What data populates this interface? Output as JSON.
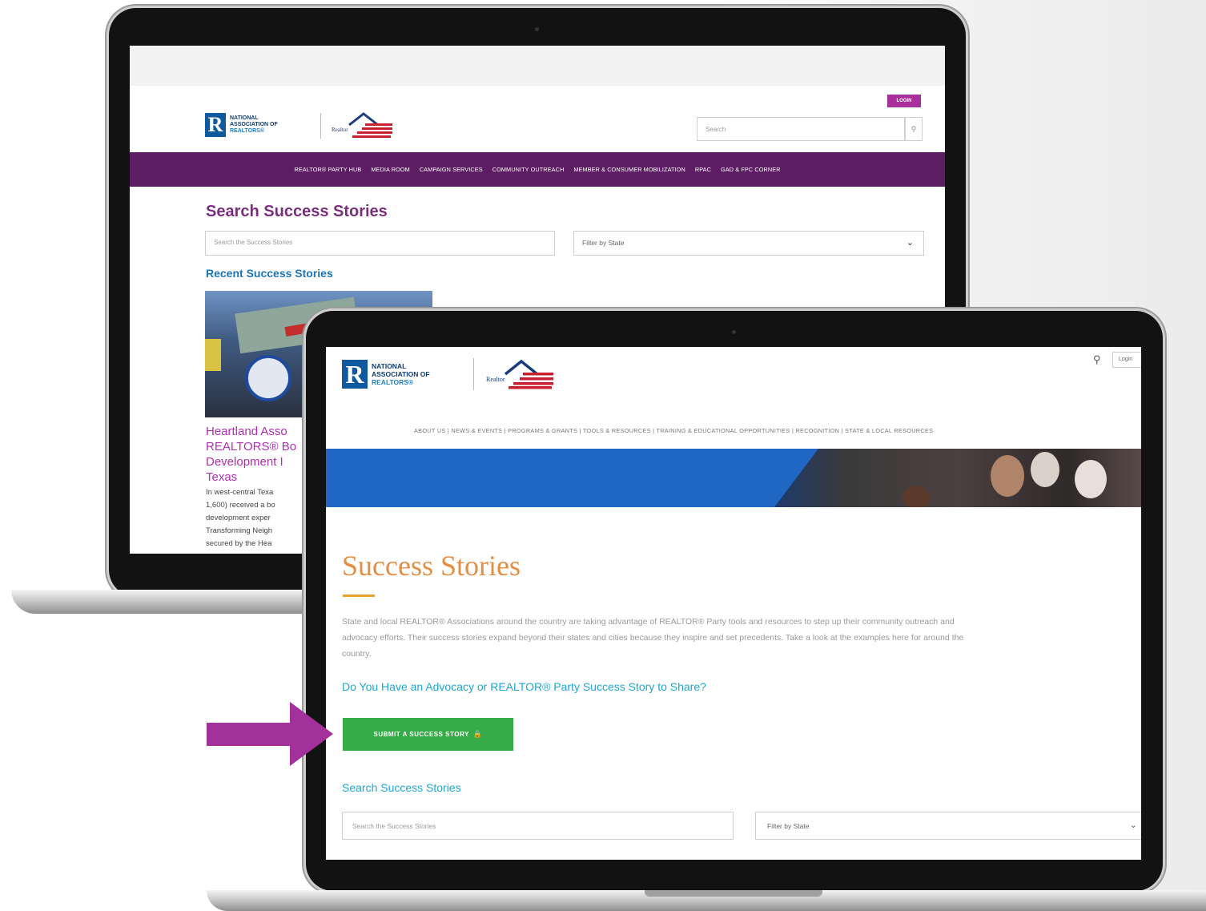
{
  "back": {
    "logo": {
      "line1": "NATIONAL",
      "line2": "ASSOCIATION OF",
      "line3": "REALTORS®"
    },
    "login_label": "LOGIN",
    "search_placeholder": "Search",
    "nav": [
      "REALTOR® PARTY HUB",
      "MEDIA ROOM",
      "CAMPAIGN SERVICES",
      "COMMUNITY OUTREACH",
      "MEMBER & CONSUMER MOBILIZATION",
      "RPAC",
      "GAD & FPC CORNER"
    ],
    "page_title": "Search Success Stories",
    "story_search_placeholder": "Search the Success Stories",
    "state_filter": "Filter by State",
    "recent_heading": "Recent Success Stories",
    "story": {
      "title_lines": [
        "Heartland Asso",
        "REALTORS® Bo",
        "Development I",
        "Texas"
      ],
      "text_lines": [
        "In west-central Texa",
        "1,600) received a bo",
        "development exper",
        "Transforming Neigh",
        "secured by the Hea"
      ]
    }
  },
  "front": {
    "logo": {
      "line1": "NATIONAL",
      "line2": "ASSOCIATION OF",
      "line3": "REALTORS®"
    },
    "login_label": "Login",
    "nav": "ABOUT US | NEWS & EVENTS | PROGRAMS & GRANTS | TOOLS & RESOURCES | TRAINING & EDUCATIONAL OPPORTUNITIES | RECOGNITION | STATE & LOCAL RESOURCES",
    "page_title": "Success Stories",
    "intro_lines": [
      "State and local REALTOR® Associations around the country are taking advantage of REALTOR® Party tools and resources to step up their community outreach and",
      "advocacy efforts. Their success stories expand beyond their states and cities because they inspire and set precedents. Take a look at the examples here for around the",
      "country."
    ],
    "question": "Do You Have an Advocacy or REALTOR® Party Success Story to Share?",
    "submit_label": "SUBMIT A SUCCESS STORY",
    "search_heading": "Search Success Stories",
    "story_search_placeholder": "Search the Success Stories",
    "state_filter": "Filter by State"
  },
  "colors": {
    "purple_nav": "#5c1d62",
    "arrow": "#a3319c",
    "green_button": "#36ac48",
    "title_orange": "#e38e43",
    "link_cyan": "#1fa6cf"
  }
}
